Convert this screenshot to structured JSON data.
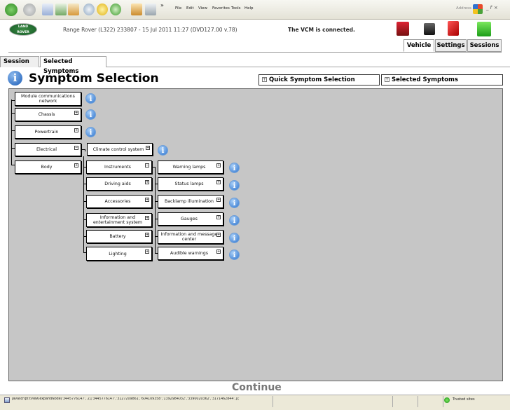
{
  "browser": {
    "menu": [
      "File",
      "Edit",
      "View",
      "Favorites",
      "Tools",
      "Help"
    ],
    "address_label": "Address",
    "chevron": "»",
    "window_controls": "_ ř ×"
  },
  "header": {
    "logo_line1": "LAND",
    "logo_line2": "ROVER",
    "vehicle_info": "Range Rover (L322) 233807 - 15 Jul 2011 11:27 (DVD127.00 v.78)",
    "vcm_status": "The VCM is connected.",
    "tabs": [
      "Vehicle",
      "Settings",
      "Sessions"
    ]
  },
  "subtabs": [
    "Session",
    "Selected Symptoms"
  ],
  "page": {
    "info_glyph": "i",
    "title": "Symptom Selection",
    "quick_label": "Quick Symptom Selection",
    "selected_label": "Selected Symptoms",
    "expand_glyph": "+",
    "collapse_glyph": "−"
  },
  "tree": {
    "level1": [
      "Module communications network",
      "Chassis",
      "Powertrain",
      "Electrical",
      "Body"
    ],
    "level2": [
      "Climate control system"
    ],
    "level3": [
      "Instruments",
      "Driving aids",
      "Accessories",
      "Information and entertainment system",
      "Battery",
      "Lighting"
    ],
    "level4": [
      "Warning lamps",
      "Status lamps",
      "Backlamp illumination",
      "Gauges",
      "Information and message center",
      "Audible warnings"
    ]
  },
  "continue_label": "Continue",
  "status": {
    "text": "javascript:tView.expandNode('3445776147', 2,['3445776147','3127209861','604109358','1392984032','3390020362','3171462844',]);",
    "zone": "Trusted sites"
  }
}
